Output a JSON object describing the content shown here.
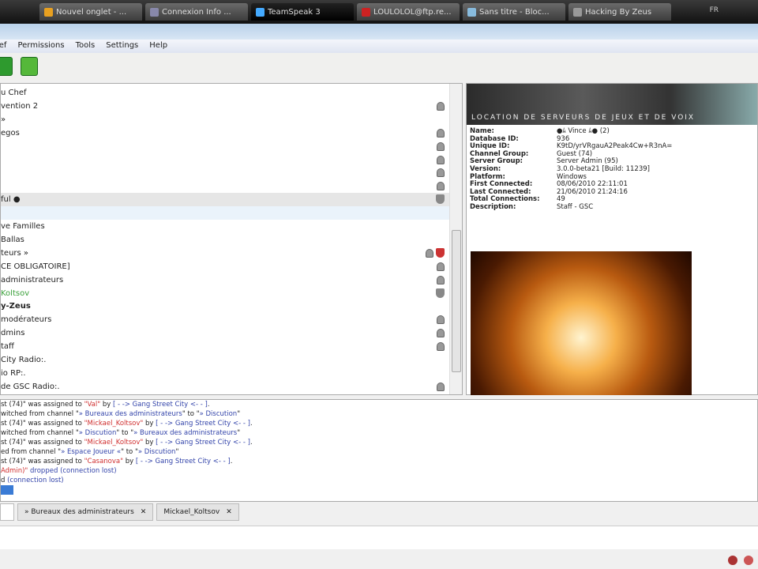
{
  "taskbar": {
    "tabs": [
      {
        "label": "Nouvel onglet - ..."
      },
      {
        "label": "Connexion Info ..."
      },
      {
        "label": "TeamSpeak 3",
        "active": true
      },
      {
        "label": "LOULOLOL@ftp.re..."
      },
      {
        "label": "Sans titre - Bloc..."
      },
      {
        "label": "Hacking By Zeus"
      }
    ],
    "tray": "FR"
  },
  "menu": [
    "ief",
    "Permissions",
    "Tools",
    "Settings",
    "Help"
  ],
  "tree": [
    {
      "label": "u Chef"
    },
    {
      "label": "vention 2",
      "icon": "lock"
    },
    {
      "label": " »"
    },
    {
      "label": "egos",
      "icon": "lock"
    },
    {
      "label": "",
      "icon": "lock"
    },
    {
      "label": "",
      "icon": "lock"
    },
    {
      "label": "",
      "icon": "lock"
    },
    {
      "label": "",
      "icon": "lock"
    },
    {
      "label": "ful ●",
      "icon": "shield",
      "selected": true
    },
    {
      "label": "",
      "band": true
    },
    {
      "label": "ve Familles"
    },
    {
      "label": "Ballas"
    },
    {
      "label": "teurs »",
      "icon": "lock-shield-red"
    },
    {
      "label": "CE OBLIGATOIRE]",
      "icon": "lock"
    },
    {
      "label": "administrateurs",
      "icon": "lock"
    },
    {
      "label": "Koltsov",
      "icon": "shield",
      "color": "#3aa03a"
    },
    {
      "label": "y-Zeus",
      "bold": true
    },
    {
      "label": "modérateurs",
      "icon": "lock"
    },
    {
      "label": "dmins",
      "icon": "lock"
    },
    {
      "label": "taff",
      "icon": "lock"
    },
    {
      "label": "City Radio:."
    },
    {
      "label": "io RP:."
    },
    {
      "label": "de GSC Radio:.",
      "icon": "lock"
    }
  ],
  "info": {
    "banner": "LOCATION DE SERVEURS DE JEUX ET DE VOIX",
    "fields": [
      {
        "k": "Name:",
        "v": "●ﾑ Vince ﾑ● (2)"
      },
      {
        "k": "Database ID:",
        "v": "936"
      },
      {
        "k": "Unique ID:",
        "v": "K9tD/yrVRgauA2Peak4Cw+R3nA="
      },
      {
        "k": "Channel Group:",
        "v": "Guest (74)"
      },
      {
        "k": "Server Group:",
        "v": "Server Admin (95)"
      },
      {
        "k": "Version:",
        "v": "3.0.0-beta21 [Build: 11239]"
      },
      {
        "k": "Platform:",
        "v": "Windows"
      },
      {
        "k": "First Connected:",
        "v": "08/06/2010 22:11:01"
      },
      {
        "k": "Last Connected:",
        "v": "21/06/2010 21:24:16"
      },
      {
        "k": "Total Connections:",
        "v": "49"
      },
      {
        "k": "Description:",
        "v": "Staff - GSC"
      }
    ]
  },
  "log": [
    [
      [
        "st (74)\" was assigned to ",
        "t"
      ],
      [
        "\"Val\"",
        "r"
      ],
      [
        " by ",
        "t"
      ],
      [
        "[ - -> Gang Street City <- - ]",
        "b"
      ],
      [
        ".",
        "t"
      ]
    ],
    [
      [
        "witched from channel \"",
        "t"
      ],
      [
        "» Bureaux des administrateurs",
        "b"
      ],
      [
        "\" to \"",
        "t"
      ],
      [
        "» Discution",
        "b"
      ],
      [
        "\"",
        "t"
      ]
    ],
    [
      [
        "st (74)\" was assigned to ",
        "t"
      ],
      [
        "\"Mickael_Koltsov\"",
        "r"
      ],
      [
        " by ",
        "t"
      ],
      [
        "[ - -> Gang Street City <- - ]",
        "b"
      ],
      [
        ".",
        "t"
      ]
    ],
    [
      [
        "witched from channel \"",
        "t"
      ],
      [
        "» Discution",
        "b"
      ],
      [
        "\" to \"",
        "t"
      ],
      [
        "» Bureaux des administrateurs",
        "b"
      ],
      [
        "\"",
        "t"
      ]
    ],
    [
      [
        "st (74)\" was assigned to ",
        "t"
      ],
      [
        "\"Mickael_Koltsov\"",
        "r"
      ],
      [
        " by ",
        "t"
      ],
      [
        "[ - -> Gang Street City <- - ]",
        "b"
      ],
      [
        ".",
        "t"
      ]
    ],
    [
      [
        "ed from channel \"",
        "t"
      ],
      [
        "» Espace Joueur «",
        "b"
      ],
      [
        "\" to \"",
        "t"
      ],
      [
        "» Discution",
        "b"
      ],
      [
        "\"",
        "t"
      ]
    ],
    [
      [
        "st (74)\" was assigned to ",
        "t"
      ],
      [
        "\"Casanova\"",
        "r"
      ],
      [
        " by ",
        "t"
      ],
      [
        "[ - -> Gang Street City <- - ]",
        "b"
      ],
      [
        ".",
        "t"
      ]
    ],
    [
      [
        "Admin)\"",
        "r"
      ],
      [
        " dropped ",
        "b"
      ],
      [
        "(connection lost)",
        "b"
      ]
    ],
    [
      [
        "d ",
        "t"
      ],
      [
        "(connection lost)",
        "b"
      ]
    ]
  ],
  "chat_tabs": [
    {
      "label": "» Bureaux des administrateurs"
    },
    {
      "label": "Mickael_Koltsov"
    }
  ]
}
